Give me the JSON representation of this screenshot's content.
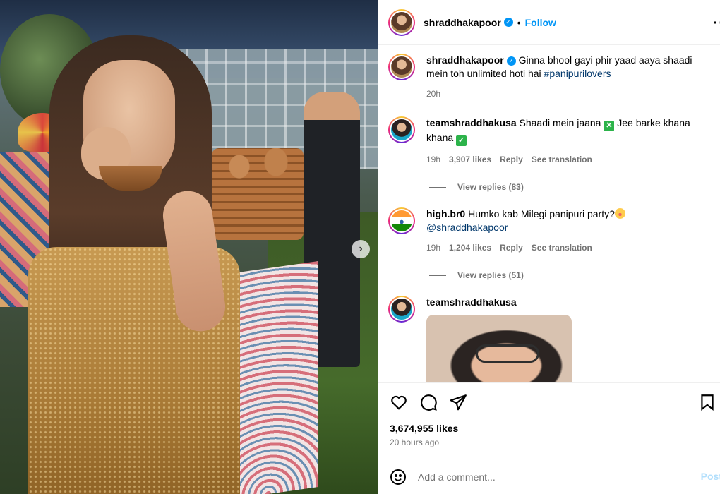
{
  "post": {
    "author": "shraddhakapoor",
    "follow_label": "Follow",
    "dot": "•",
    "caption_user": "shraddhakapoor",
    "caption_text": "Ginna bhool gayi phir yaad aaya shaadi mein toh unlimited hoti hai",
    "caption_hashtag": "#panipurilovers",
    "caption_time": "20h",
    "likes": "3,674,955 likes",
    "posted_ago": "20 hours ago"
  },
  "comments": [
    {
      "user": "teamshraddhakusa",
      "text_a": "Shaadi mein jaana",
      "text_b": "Jee barke khana khana",
      "time": "19h",
      "likes": "3,907 likes",
      "reply": "Reply",
      "translate": "See translation",
      "view_replies": "View replies (83)"
    },
    {
      "user": "high.br0",
      "text": "Humko kab Milegi panipuri party?",
      "mention": "@shraddhakapoor",
      "time": "19h",
      "likes": "1,204 likes",
      "reply": "Reply",
      "translate": "See translation",
      "view_replies": "View replies (51)"
    },
    {
      "user": "teamshraddhakusa"
    }
  ],
  "add_comment": {
    "placeholder": "Add a comment...",
    "post_label": "Post"
  },
  "icons": {
    "next": "chevron-right-icon",
    "like": "heart-icon",
    "comment": "comment-icon",
    "share": "send-icon",
    "save": "bookmark-icon",
    "emoji": "emoji-icon",
    "more": "more-icon"
  },
  "colors": {
    "link": "#0095f6",
    "hashtag": "#00376b",
    "muted": "#737373"
  }
}
